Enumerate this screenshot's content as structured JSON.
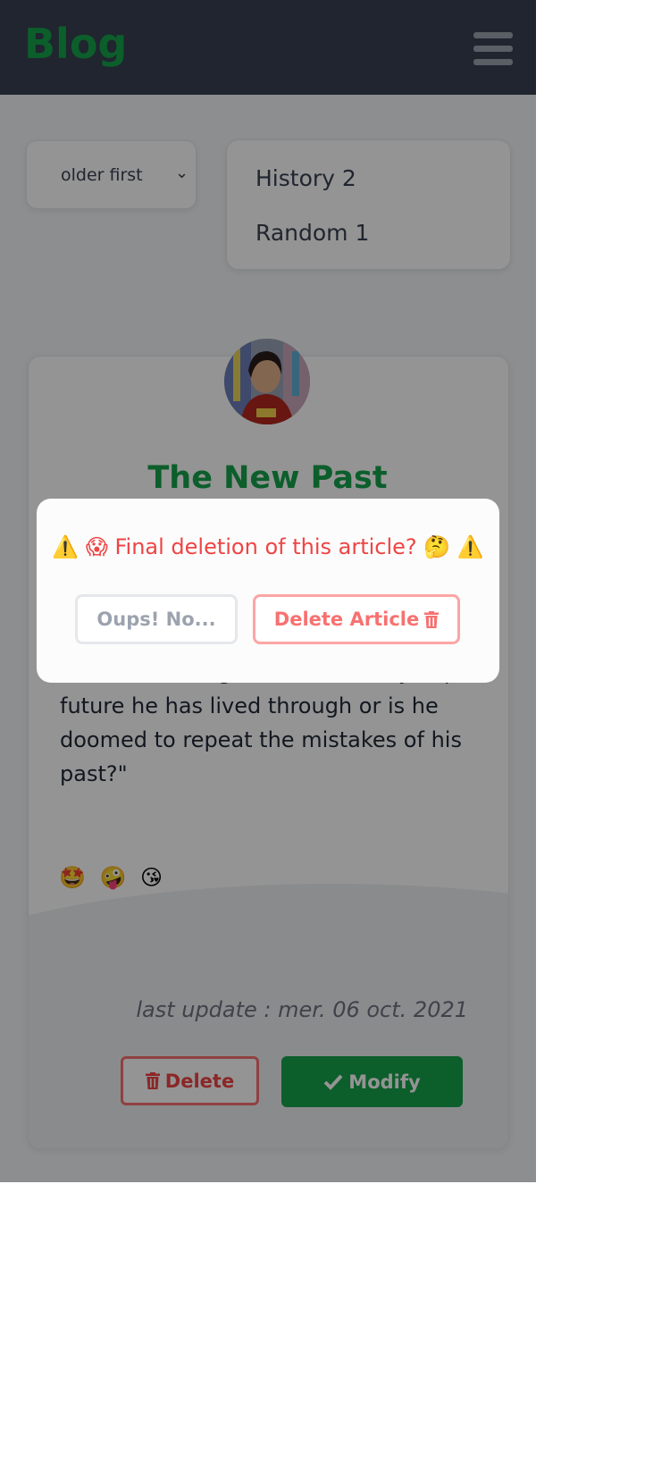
{
  "header": {
    "logo": "Blog",
    "menu_icon": "hamburger-menu-icon"
  },
  "filters": {
    "sort_value": "older first",
    "sort_icon": "chevron-down-icon",
    "categories": [
      {
        "label": "History 2"
      },
      {
        "label": "Random 1"
      }
    ]
  },
  "article": {
    "title": "The New Past",
    "excerpt": "use is knowledge to avert the dystopian future he has lived through or is he doomed to repeat the mistakes of his past?\"",
    "emojis": "🤩 🤪 😘",
    "date": "last update : mer. 06 oct. 2021",
    "delete_label": "Delete",
    "modify_label": "Modify"
  },
  "modal": {
    "message": "⚠️ 😱 Final deletion of this article? 🤔 ⚠️",
    "cancel_label": "Oups! No...",
    "confirm_label": "Delete Article"
  },
  "colors": {
    "brand_green": "#16a34a",
    "header_bg": "#374151",
    "danger_red": "#ef4444",
    "overlay": "rgba(0,0,0,0.42)"
  }
}
